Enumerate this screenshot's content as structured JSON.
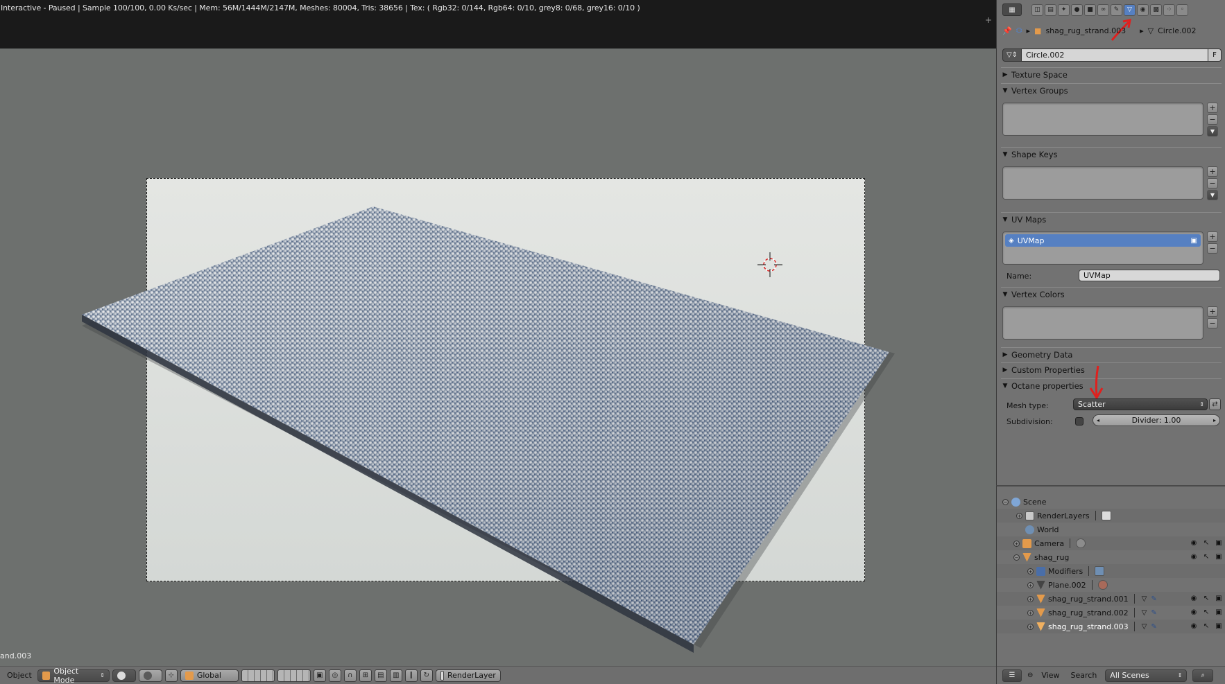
{
  "viewport": {
    "status_text": "Interactive - Paused | Sample 100/100, 0.00 Ks/sec | Mem: 56M/1444M/2147M, Meshes: 80004, Tris: 38656 | Tex: ( Rgb32: 0/144, Rgb64: 0/10, grey8: 0/68, grey16: 0/10 )",
    "plus_icon": "+",
    "object_name": "and.003",
    "footer": {
      "menu_object": "Object",
      "mode": "Object Mode",
      "orientation": "Global",
      "render_layer": "RenderLayer"
    }
  },
  "properties": {
    "tab_icons": [
      "render-icon",
      "render-layers-icon",
      "scene-icon",
      "world-icon",
      "object-icon",
      "constraints-icon",
      "modifiers-icon",
      "data-icon",
      "material-icon",
      "texture-icon",
      "particles-icon",
      "physics-icon"
    ],
    "active_tab": "data-icon",
    "breadcrumb": {
      "object": "shag_rug_strand.003",
      "mesh": "Circle.002"
    },
    "datablock": {
      "name": "Circle.002",
      "fake_user": "F"
    },
    "panels": {
      "texture_space": "Texture Space",
      "vertex_groups": "Vertex Groups",
      "shape_keys": "Shape Keys",
      "uv_maps": "UV Maps",
      "vertex_colors": "Vertex Colors",
      "geometry_data": "Geometry Data",
      "custom_properties": "Custom Properties",
      "octane_properties": "Octane properties"
    },
    "uv_map_item": "UVMap",
    "uv_name_label": "Name:",
    "uv_name_value": "UVMap",
    "mesh_type_label": "Mesh type:",
    "mesh_type_value": "Scatter",
    "subdivision_label": "Subdivision:",
    "divider_value": "Divider: 1.00",
    "add_label": "+",
    "remove_label": "−",
    "down_label": "▼"
  },
  "outliner": {
    "rows": [
      {
        "label": "Scene",
        "icon": "scene-icon",
        "color": "#7fa6d6"
      },
      {
        "label": "RenderLayers",
        "icon": "render-layers-icon",
        "color": "#c9c9c9"
      },
      {
        "label": "World",
        "icon": "world-icon",
        "color": "#6f8fb3"
      },
      {
        "label": "Camera",
        "icon": "camera-icon",
        "color": "#e39a4b"
      },
      {
        "label": "shag_rug",
        "icon": "mesh-object-icon",
        "color": "#e39a4b"
      },
      {
        "label": "Modifiers",
        "icon": "wrench-icon",
        "color": "#4a6ea8"
      },
      {
        "label": "Plane.002",
        "icon": "mesh-data-icon",
        "color": "#444444"
      },
      {
        "label": "shag_rug_strand.001",
        "icon": "mesh-object-icon",
        "color": "#e39a4b"
      },
      {
        "label": "shag_rug_strand.002",
        "icon": "mesh-object-icon",
        "color": "#e39a4b"
      },
      {
        "label": "shag_rug_strand.003",
        "icon": "mesh-object-icon",
        "color": "#e39a4b"
      }
    ],
    "footer": {
      "view": "View",
      "search": "Search",
      "scenes": "All Scenes"
    }
  },
  "colors": {
    "accent": "#5680c2",
    "annotation": "#e0201e"
  }
}
